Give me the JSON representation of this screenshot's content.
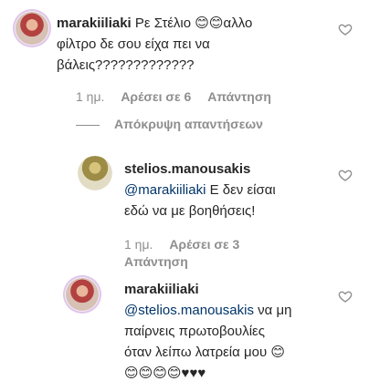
{
  "comments": [
    {
      "username": "marakiiliaki",
      "text_line1": "Ρε Στέλιο 😊😊αλλο",
      "text_line2": "φίλτρο δε σου είχα πει να",
      "text_line3": "βάλεις?????????????",
      "time": "1 ημ.",
      "likes": "Αρέσει σε 6",
      "reply": "Απάντηση"
    },
    {
      "username": "stelios.manousakis",
      "mention": "@marakiiliaki",
      "text_line1_rest": " Ε δεν είσαι",
      "text_line2": "εδώ να με βοηθήσεις!",
      "time": "1 ημ.",
      "likes": "Αρέσει σε 3",
      "reply": "Απάντηση"
    },
    {
      "username": "marakiiliaki",
      "mention": "@stelios.manousakis",
      "text_line1_rest": " να μη",
      "text_line2": "παίρνεις πρωτοβουλίες",
      "text_line3": "όταν λείπω λατρεία μου 😊",
      "text_line4": "😊😊😊😊♥♥♥"
    }
  ],
  "hide_replies": "Απόκρυψη απαντήσεων",
  "colors": {
    "text": "#262626",
    "muted": "#8e8e8e",
    "mention": "#003569",
    "heart_outline": "#8e8e8e"
  },
  "icons": [
    "heart-icon"
  ]
}
